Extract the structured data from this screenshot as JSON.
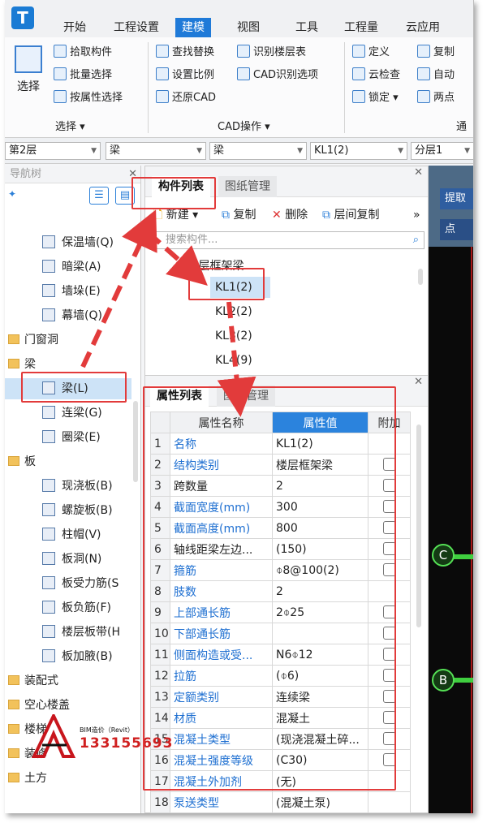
{
  "app": {
    "logo": "T"
  },
  "tabs": [
    "开始",
    "工程设置",
    "建模",
    "视图",
    "工具",
    "工程量",
    "云应用"
  ],
  "ribbon": {
    "select_label": "选择",
    "select_group": [
      "拾取构件",
      "批量选择",
      "按属性选择"
    ],
    "select_group_label": "选择",
    "cad_group": [
      "查找替换",
      "识别楼层表",
      "设置比例",
      "CAD识别选项",
      "还原CAD"
    ],
    "cad_group_label": "CAD操作",
    "general_group": [
      "定义",
      "复制",
      "云检查",
      "自动",
      "锁定",
      "两点"
    ],
    "general_group_label": "通"
  },
  "selectors": [
    "第2层",
    "梁",
    "梁",
    "KL1(2)",
    "分层1"
  ],
  "nav": {
    "title": "导航树",
    "items": [
      {
        "label": "保温墙(Q)",
        "kind": "leaf",
        "icon": "insulation-wall-icon"
      },
      {
        "label": "暗梁(A)",
        "kind": "leaf",
        "icon": "hidden-beam-icon"
      },
      {
        "label": "墙垛(E)",
        "kind": "leaf",
        "icon": "wall-pier-icon"
      },
      {
        "label": "幕墙(Q)",
        "kind": "leaf",
        "icon": "curtain-wall-icon"
      },
      {
        "label": "门窗洞",
        "kind": "category",
        "icon": "folder-icon"
      },
      {
        "label": "梁",
        "kind": "category",
        "icon": "folder-icon"
      },
      {
        "label": "梁(L)",
        "kind": "leaf",
        "icon": "beam-icon",
        "selected": true
      },
      {
        "label": "连梁(G)",
        "kind": "leaf",
        "icon": "coupling-beam-icon"
      },
      {
        "label": "圈梁(E)",
        "kind": "leaf",
        "icon": "ring-beam-icon"
      },
      {
        "label": "板",
        "kind": "category",
        "icon": "folder-icon"
      },
      {
        "label": "现浇板(B)",
        "kind": "leaf",
        "icon": "cast-slab-icon"
      },
      {
        "label": "螺旋板(B)",
        "kind": "leaf",
        "icon": "spiral-slab-icon"
      },
      {
        "label": "柱帽(V)",
        "kind": "leaf",
        "icon": "column-cap-icon"
      },
      {
        "label": "板洞(N)",
        "kind": "leaf",
        "icon": "slab-hole-icon"
      },
      {
        "label": "板受力筋(S",
        "kind": "leaf",
        "icon": "slab-rebar-icon"
      },
      {
        "label": "板负筋(F)",
        "kind": "leaf",
        "icon": "slab-negative-rebar-icon"
      },
      {
        "label": "楼层板带(H",
        "kind": "leaf",
        "icon": "slab-strip-icon"
      },
      {
        "label": "板加腋(B)",
        "kind": "leaf",
        "icon": "slab-haunch-icon"
      },
      {
        "label": "装配式",
        "kind": "category",
        "icon": "folder-icon"
      },
      {
        "label": "空心楼盖",
        "kind": "category",
        "icon": "folder-icon"
      },
      {
        "label": "楼梯",
        "kind": "category",
        "icon": "folder-icon"
      },
      {
        "label": "装修",
        "kind": "category",
        "icon": "folder-icon"
      },
      {
        "label": "土方",
        "kind": "category",
        "icon": "folder-icon"
      }
    ]
  },
  "component_panel": {
    "tabs": [
      "构件列表",
      "图纸管理"
    ],
    "toolbar": [
      "新建",
      "复制",
      "删除",
      "层间复制"
    ],
    "search_placeholder": "搜索构件...",
    "tree_group": "楼层框架梁",
    "items": [
      "KL1(2)",
      "KL2(2)",
      "KL3(2)",
      "KL4(9)"
    ],
    "selected_index": 0
  },
  "property_panel": {
    "tabs": [
      "属性列表",
      "图层管理"
    ],
    "headers": [
      "属性名称",
      "属性值",
      "附加"
    ],
    "rows": [
      {
        "num": "1",
        "name": "名称",
        "value": "KL1(2)",
        "blue": true,
        "check": false
      },
      {
        "num": "2",
        "name": "结构类别",
        "value": "楼层框架梁",
        "blue": true,
        "check": true
      },
      {
        "num": "3",
        "name": "跨数量",
        "value": "2",
        "blue": false,
        "check": true
      },
      {
        "num": "4",
        "name": "截面宽度(mm)",
        "value": "300",
        "blue": true,
        "check": true
      },
      {
        "num": "5",
        "name": "截面高度(mm)",
        "value": "800",
        "blue": true,
        "check": true
      },
      {
        "num": "6",
        "name": "轴线距梁左边...",
        "value": "(150)",
        "blue": false,
        "check": true
      },
      {
        "num": "7",
        "name": "箍筋",
        "value": "⌽8@100(2)",
        "blue": true,
        "check": true
      },
      {
        "num": "8",
        "name": "肢数",
        "value": "2",
        "blue": true,
        "check": false
      },
      {
        "num": "9",
        "name": "上部通长筋",
        "value": "2⌽25",
        "blue": true,
        "check": true
      },
      {
        "num": "10",
        "name": "下部通长筋",
        "value": "",
        "blue": true,
        "check": true
      },
      {
        "num": "11",
        "name": "侧面构造或受...",
        "value": "N6⌽12",
        "blue": true,
        "check": true
      },
      {
        "num": "12",
        "name": "拉筋",
        "value": "(⌽6)",
        "blue": true,
        "check": true
      },
      {
        "num": "13",
        "name": "定额类别",
        "value": "连续梁",
        "blue": true,
        "check": true
      },
      {
        "num": "14",
        "name": "材质",
        "value": "混凝土",
        "blue": true,
        "check": true
      },
      {
        "num": "15",
        "name": "混凝土类型",
        "value": "(现浇混凝土碎...",
        "blue": true,
        "check": true
      },
      {
        "num": "16",
        "name": "混凝土强度等级",
        "value": "(C30)",
        "blue": true,
        "check": true
      },
      {
        "num": "17",
        "name": "混凝土外加剂",
        "value": "(无)",
        "blue": true,
        "check": false
      },
      {
        "num": "18",
        "name": "泵送类型",
        "value": "(混凝土泵)",
        "blue": true,
        "check": false
      }
    ]
  },
  "canvas": {
    "buttons": [
      "提取",
      "点"
    ],
    "axes": [
      "C",
      "B"
    ]
  },
  "watermark": {
    "line1": "BIM造价（Revit）",
    "phone": "133155693"
  }
}
